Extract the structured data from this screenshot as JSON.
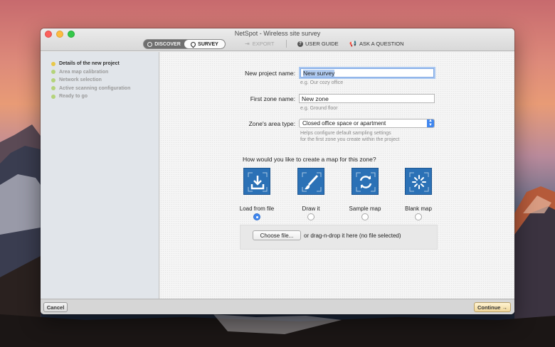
{
  "window": {
    "title": "NetSpot - Wireless site survey"
  },
  "toolbar": {
    "mode_discover": "DISCOVER",
    "mode_survey": "SURVEY",
    "export": "EXPORT",
    "user_guide": "USER GUIDE",
    "ask_question": "ASK A QUESTION"
  },
  "sidebar": {
    "steps": [
      {
        "label": "Details of the new project"
      },
      {
        "label": "Area map calibration"
      },
      {
        "label": "Network selection"
      },
      {
        "label": "Active scanning configuration"
      },
      {
        "label": "Ready to go"
      }
    ]
  },
  "form": {
    "project_name_label": "New project name:",
    "project_name_value": "New survey",
    "project_name_hint": "e.g. Our cozy office",
    "zone_name_label": "First zone name:",
    "zone_name_value": "New zone",
    "zone_name_hint": "e.g. Ground floor",
    "zone_type_label": "Zone's area type:",
    "zone_type_value": "Closed office space or apartment",
    "zone_type_hint_1": "Helps configure default sampling settings",
    "zone_type_hint_2": "for the first zone you create within the project",
    "map_question": "How would you like to create a map for this zone?",
    "options": [
      {
        "label": "Load from file",
        "selected": true
      },
      {
        "label": "Draw it",
        "selected": false
      },
      {
        "label": "Sample map",
        "selected": false
      },
      {
        "label": "Blank map",
        "selected": false
      }
    ],
    "choose_file": "Choose file...",
    "drop_text": "or drag-n-drop it here (no file selected)"
  },
  "footer": {
    "cancel": "Cancel",
    "continue": "Continue →"
  },
  "colors": {
    "accent": "#3f86ef",
    "tile": "#2b71b6",
    "active_step": "#e8c84a",
    "done_step": "#b4d37a"
  }
}
